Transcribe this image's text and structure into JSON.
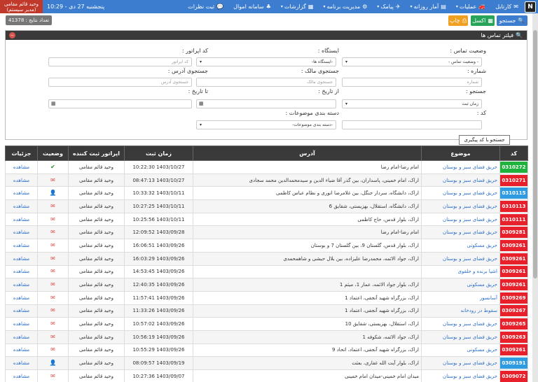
{
  "navbar": {
    "brand": "N",
    "items": [
      {
        "label": "کارتابل",
        "icon": "inbox-icon",
        "glyph": "✉"
      },
      {
        "label": "عملیات",
        "icon": "truck-icon",
        "glyph": "🚒"
      },
      {
        "label": "آمار روزانه",
        "icon": "bar-chart-icon",
        "glyph": "▤"
      },
      {
        "label": "پیامک",
        "icon": "send-icon",
        "glyph": "✈"
      },
      {
        "label": "مدیریت برنامه",
        "icon": "cogs-icon",
        "glyph": "⚙"
      },
      {
        "label": "گزارشات",
        "icon": "report-icon",
        "glyph": "▦"
      },
      {
        "label": "سامانه اموال",
        "icon": "sitemap-icon",
        "glyph": "♣"
      },
      {
        "label": "ثبت نظرات",
        "icon": "comment-icon",
        "glyph": "💬"
      }
    ],
    "date": "پنجشنبه 27 دی - 10:29",
    "user_name": "وحید قائم مقامی",
    "user_role": "(مدیر سیستم)"
  },
  "toolbar": {
    "search_label": "جستجو",
    "excel_label": "اکسل",
    "print_label": "چاپ",
    "count_label": "تعداد نتایج : 41378"
  },
  "filter": {
    "title": "فیلتر تماس ها",
    "fields": {
      "status_label": "وضعیت تماس :",
      "status_value": "- وضعیت تماس -",
      "station_label": "ایستگاه :",
      "station_value": "-ایستگاه ها-",
      "operator_label": "کد اپراتور :",
      "operator_placeholder": "کد اپراتور",
      "number_label": "شماره :",
      "number_placeholder": "شماره",
      "owner_label": "جستجوی مالک :",
      "owner_placeholder": "جستجوی مالک",
      "address_label": "جستجوی آدرس :",
      "address_placeholder": "جستجوی آدرس",
      "search_label": "جستجو :",
      "search_value": "زمان ثبت",
      "from_label": "از تاریخ :",
      "to_label": "تا تاریخ :",
      "code_label": "کد :",
      "category_label": "دسته بندی موضوعات :",
      "category_value": "-دسته بندی موضوعات-"
    },
    "tooltip": "جستجو با کد پیگیری"
  },
  "table": {
    "headers": {
      "code": "کد",
      "subject": "موضوع",
      "address": "آدرس",
      "time": "زمان ثبت",
      "operator": "اپراتور ثبت کننده",
      "status": "وضعیت",
      "details": "جزئیات"
    },
    "detail_label": "مشاهده",
    "rows": [
      {
        "code": "0310272",
        "color": "green",
        "subject": "حریق فضای سبز و بوستان",
        "address": "امام رضا-امام رضا",
        "time": "1403/10/27 10:22:30",
        "operator": "وحید قائم مقامی",
        "status": "check"
      },
      {
        "code": "0310271",
        "color": "red",
        "subject": "حریق فضای سبز و بوستان",
        "address": "اراک، امام خمینی، پاسداران، بین گذر آقا ضیاء الدین و سیدمحمدالدین محمد سجادی",
        "time": "1403/10/27 08:47:13",
        "operator": "وحید قائم مقامی",
        "status": "mail"
      },
      {
        "code": "0310115",
        "color": "blue",
        "subject": "حریق فضای سبز و بوستان",
        "address": "اراک، دانشگاه، سردار جنگل، بین غلامرضا انوری و نظام عباس کاظمی",
        "time": "1403/10/11 10:33:32",
        "operator": "وحید قائم مقامی",
        "status": "user"
      },
      {
        "code": "0310113",
        "color": "red",
        "subject": "حریق فضای سبز و بوستان",
        "address": "اراک، دانشگاه، استقلال، بهزیستی، شقایق 6",
        "time": "1403/10/11 10:27:25",
        "operator": "وحید قائم مقامی",
        "status": "mail"
      },
      {
        "code": "0310111",
        "color": "red",
        "subject": "حریق فضای سبز و بوستان",
        "address": "اراک، بلوار قدس، حاج کاظمی",
        "time": "1403/10/11 10:25:56",
        "operator": "وحید قائم مقامی",
        "status": "mail"
      },
      {
        "code": "0309281",
        "color": "red",
        "subject": "حریق فضای سبز و بوستان",
        "address": "امام رضا-امام رضا",
        "time": "1403/09/28 12:09:52",
        "operator": "وحید قائم مقامی",
        "status": "mail"
      },
      {
        "code": "0309261",
        "color": "red",
        "subject": "حریق مسکونی",
        "address": "اراک، بلوار قدس، گلستان 9، بین گلستان 7 و بوستان",
        "time": "1403/09/26 16:06:51",
        "operator": "وحید قائم مقامی",
        "status": "mail"
      },
      {
        "code": "0309261",
        "color": "red",
        "subject": "حریق فضای سبز و بوستان",
        "address": "اراک، جواد الائمه، محمدرضا علیزاده، بین بلال حبشی و شاهمحمدی",
        "time": "1403/09/26 16:03:29",
        "operator": "وحید قائم مقامی",
        "status": "mail"
      },
      {
        "code": "0309261",
        "color": "red",
        "subject": "اشیا برنده و حلقوی",
        "address": "",
        "time": "1403/09/26 14:53:45",
        "operator": "وحید قائم مقامی",
        "status": "mail"
      },
      {
        "code": "0309261",
        "color": "red",
        "subject": "حریق مسکونی",
        "address": "اراک، بلوار جواد الائمه، عمار 1، میثم 1",
        "time": "1403/09/26 12:40:35",
        "operator": "وحید قائم مقامی",
        "status": "mail"
      },
      {
        "code": "0309269",
        "color": "red",
        "subject": "آسانسور",
        "address": "اراک، بزرگراه شهید آنجفی، اعتماد 1",
        "time": "1403/09/26 11:57:41",
        "operator": "وحید قائم مقامی",
        "status": "mail"
      },
      {
        "code": "0309267",
        "color": "red",
        "subject": "سقوط در رودخانه",
        "address": "اراک، بزرگراه شهید آنجفی، اعتماد 1",
        "time": "1403/09/26 11:33:26",
        "operator": "وحید قائم مقامی",
        "status": "mail"
      },
      {
        "code": "0309265",
        "color": "red",
        "subject": "حریق فضای سبز و بوستان",
        "address": "اراک، استقلال، بهزیستی، شقایق 10",
        "time": "1403/09/26 10:57:02",
        "operator": "وحید قائم مقامی",
        "status": "mail"
      },
      {
        "code": "0309263",
        "color": "red",
        "subject": "حریق فضای سبز و بوستان",
        "address": "اراک، جواد الائمه، شکوفه 1",
        "time": "1403/09/26 10:56:19",
        "operator": "وحید قائم مقامی",
        "status": "mail"
      },
      {
        "code": "0309261",
        "color": "red",
        "subject": "حریق مسکونی",
        "address": "اراک، بزرگراه شهید آنجفی، اعتماد، اتحاد 9",
        "time": "1403/09/26 10:55:29",
        "operator": "وحید قائم مقامی",
        "status": "mail"
      },
      {
        "code": "0309191",
        "color": "blue",
        "subject": "حریق فضای سبز و بوستان",
        "address": "اراک، بلوار آیت الله غفاری، بعثت",
        "time": "1403/09/19 08:09:57",
        "operator": "وحید قائم مقامی",
        "status": "user"
      },
      {
        "code": "0309072",
        "color": "red",
        "subject": "حریق فضای سبز و بوستان",
        "address": "میدان امام خمینی-میدان امام خمینی",
        "time": "1403/09/07 10:27:36",
        "operator": "وحید قائم مقامی",
        "status": "mail"
      }
    ]
  }
}
